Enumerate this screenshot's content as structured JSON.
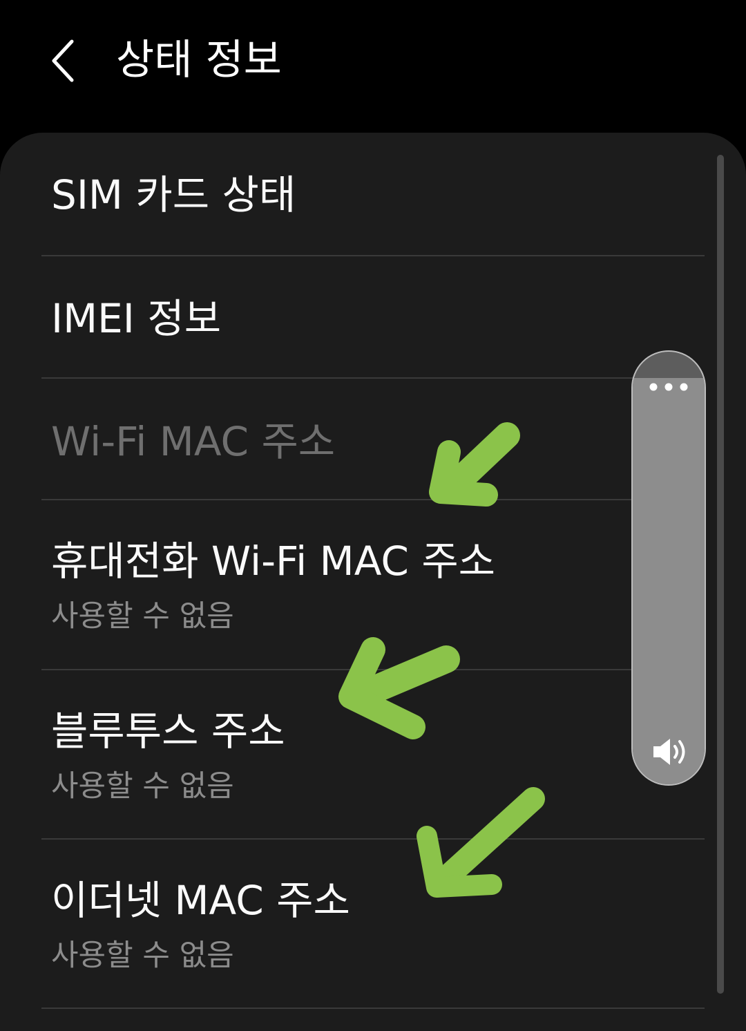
{
  "header": {
    "back_icon": "chevron-left-icon",
    "title": "상태 정보"
  },
  "settings": {
    "items": [
      {
        "title": "SIM 카드 상태",
        "subtitle": "",
        "enabled": true
      },
      {
        "title": "IMEI 정보",
        "subtitle": "",
        "enabled": true
      },
      {
        "title": "Wi-Fi MAC 주소",
        "subtitle": "",
        "enabled": false
      },
      {
        "title": "휴대전화 Wi-Fi MAC 주소",
        "subtitle": "사용할 수 없음",
        "enabled": true
      },
      {
        "title": "블루투스 주소",
        "subtitle": "사용할 수 없음",
        "enabled": true
      },
      {
        "title": "이더넷 MAC 주소",
        "subtitle": "사용할 수 없음",
        "enabled": true
      }
    ]
  },
  "volume_panel": {
    "level": 0.94,
    "menu_icon": "more-dots-icon",
    "speaker_icon": "speaker-volume-icon"
  },
  "annotations": {
    "arrow_color": "#8bc34a",
    "arrow_icon": "hand-drawn-arrow-icon"
  },
  "colors": {
    "background": "#000000",
    "panel": "#1c1c1c",
    "text": "#fafafa",
    "text_disabled": "#6f6f6f",
    "subtitle": "#8c8c8c"
  }
}
